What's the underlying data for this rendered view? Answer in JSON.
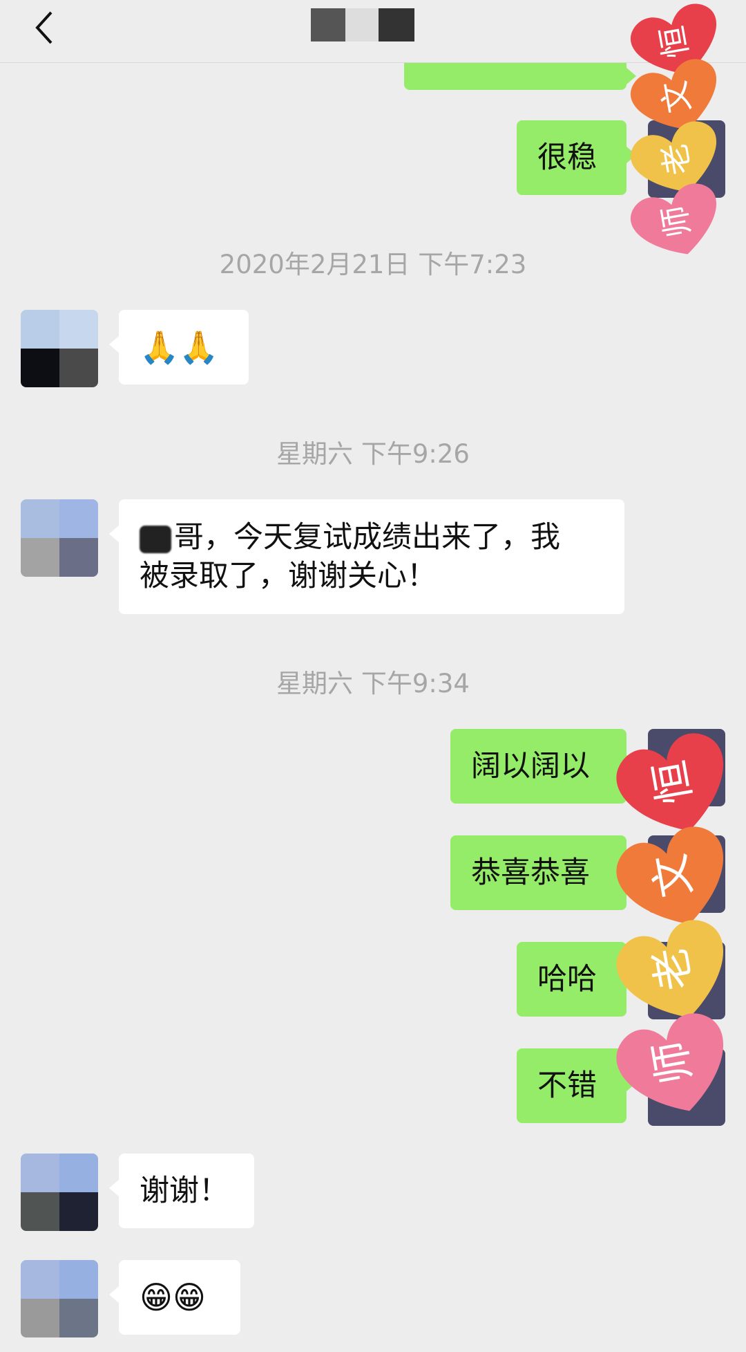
{
  "header": {
    "back_icon": "chevron-left-icon",
    "title_redacted": true,
    "more_icon": "ellipsis-icon"
  },
  "messages": [
    {
      "side": "me",
      "text": "…",
      "partial": true
    },
    {
      "side": "me",
      "text": "很稳"
    },
    {
      "type": "time",
      "text": "2020年2月21日 下午7:23"
    },
    {
      "side": "them",
      "text": "🙏🙏"
    },
    {
      "type": "time",
      "text": "星期六 下午9:26"
    },
    {
      "side": "them",
      "text_line1": "哥，今天复试成绩出来了，我",
      "text_line2": "被录取了，谢谢关心！"
    },
    {
      "type": "time",
      "text": "星期六 下午9:34"
    },
    {
      "side": "me",
      "text": "阔以阔以"
    },
    {
      "side": "me",
      "text": "恭喜恭喜"
    },
    {
      "side": "me",
      "text": "哈哈"
    },
    {
      "side": "me",
      "text": "不错"
    },
    {
      "side": "them",
      "text": "谢谢！"
    },
    {
      "side": "them",
      "text": "😁😁"
    }
  ],
  "stickers": [
    {
      "chars": [
        "恒",
        "文",
        "老",
        "师"
      ],
      "colors": [
        "#e8404a",
        "#f07a3a",
        "#f0c24a",
        "#f07a9a"
      ]
    }
  ],
  "colors": {
    "background": "#ededed",
    "me_bubble": "#95ec69",
    "them_bubble": "#ffffff",
    "time_text": "#a6a6a6"
  }
}
